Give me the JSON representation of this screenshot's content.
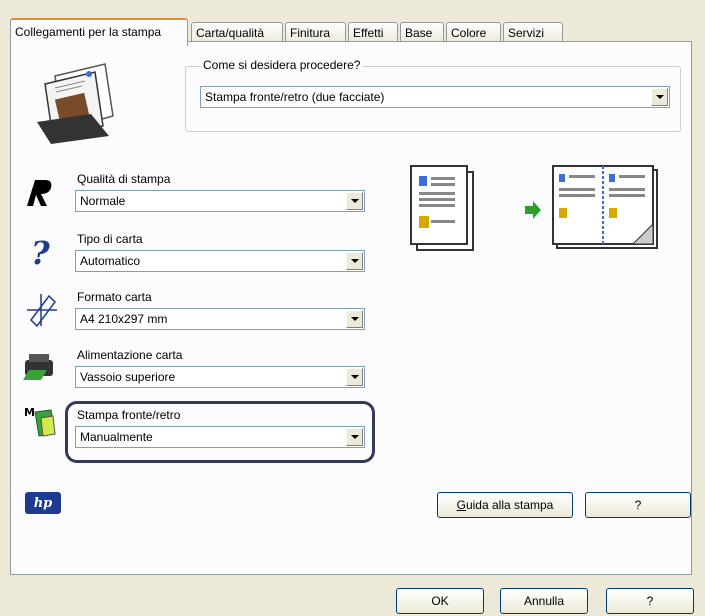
{
  "tabs": [
    {
      "label": "Collegamenti per la stampa",
      "active": true
    },
    {
      "label": "Carta/qualità"
    },
    {
      "label": "Finitura"
    },
    {
      "label": "Effetti"
    },
    {
      "label": "Base"
    },
    {
      "label": "Colore"
    },
    {
      "label": "Servizi"
    }
  ],
  "procedure": {
    "legend": "Come si desidera procedere?",
    "value": "Stampa fronte/retro (due facciate)"
  },
  "settings": {
    "quality": {
      "label": "Qualità di stampa",
      "value": "Normale"
    },
    "paper_type": {
      "label": "Tipo di carta",
      "value": "Automatico"
    },
    "paper_size": {
      "label": "Formato carta",
      "value": "A4 210x297 mm"
    },
    "paper_source": {
      "label": "Alimentazione carta",
      "value": "Vassoio superiore"
    },
    "duplex": {
      "label": "Stampa fronte/retro",
      "value": "Manualmente"
    }
  },
  "panel_buttons": {
    "guide_rest": "uida alla stampa",
    "guide_accel": "G",
    "help": "?"
  },
  "dialog_buttons": {
    "ok": "OK",
    "cancel": "Annulla",
    "help": "?"
  },
  "logo": "hp",
  "colors": {
    "accent_tab": "#e68b2c",
    "highlight": "#35395a",
    "arrow": "#2ca02c"
  }
}
